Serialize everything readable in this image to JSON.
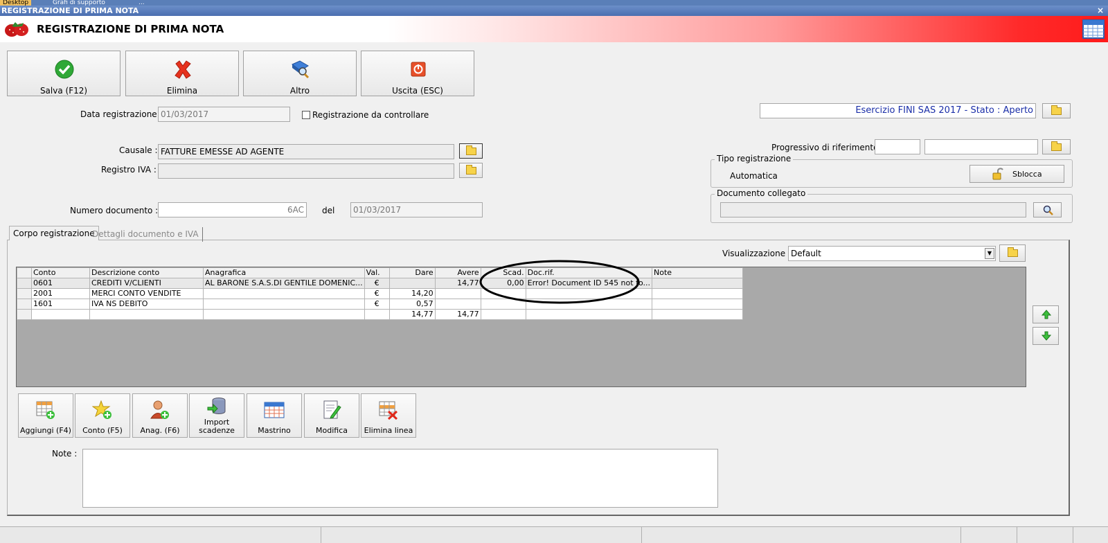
{
  "taskbar": {
    "tabs": [
      "Desktop",
      "Grafi di supporto",
      "..."
    ]
  },
  "window": {
    "title": "REGISTRAZIONE DI PRIMA NOTA",
    "close": "×"
  },
  "header": {
    "title": "REGISTRAZIONE DI PRIMA NOTA"
  },
  "toolbar": {
    "save": "Salva (F12)",
    "delete": "Elimina",
    "other": "Altro",
    "exit": "Uscita (ESC)"
  },
  "form": {
    "data_registrazione_label": "Data registrazione :",
    "data_registrazione": "01/03/2017",
    "da_controllare_label": "Registrazione da controllare",
    "causale_label": "Causale :",
    "causale": "FATTURE EMESSE AD AGENTE",
    "registro_iva_label": "Registro IVA :",
    "registro_iva": "",
    "numero_documento_label": "Numero documento :",
    "numero_documento": "6AC",
    "del_label": "del",
    "data_documento": "01/03/2017"
  },
  "right_panel": {
    "esercizio": "Esercizio FINI SAS 2017 - Stato : Aperto",
    "progressivo_label": "Progressivo di riferimento :",
    "progressivo_1": "",
    "progressivo_2": "",
    "tipo_registrazione_title": "Tipo registrazione",
    "tipo_registrazione": "Automatica",
    "sblocca": "Sblocca",
    "documento_collegato_title": "Documento collegato",
    "documento_collegato": ""
  },
  "tabs": [
    {
      "label": "Corpo registrazione",
      "active": true
    },
    {
      "label": "Dettagli documento e IVA",
      "active": false
    }
  ],
  "visualizzazione": {
    "label": "Visualizzazione :",
    "value": "Default"
  },
  "grid": {
    "columns": [
      "Conto",
      "Descrizione conto",
      "Anagrafica",
      "Val.",
      "Dare",
      "Avere",
      "Scad.",
      "Doc.rif.",
      "Note"
    ],
    "rows": [
      [
        "0601",
        "CREDITI V/CLIENTI",
        "AL BARONE S.A.S.DI GENTILE DOMENIC...",
        "€",
        "",
        "14,77",
        "0,00",
        "Error! Document ID 545 not fo...",
        ""
      ],
      [
        "2001",
        "MERCI CONTO VENDITE",
        "",
        "€",
        "14,20",
        "",
        "",
        "",
        ""
      ],
      [
        "1601",
        "IVA NS DEBITO",
        "",
        "€",
        "0,57",
        "",
        "",
        "",
        ""
      ]
    ],
    "totals": {
      "dare": "14,77",
      "avere": "14,77"
    }
  },
  "bottom_buttons": {
    "aggiungi": "Aggiungi (F4)",
    "conto": "Conto (F5)",
    "anag": "Anag. (F6)",
    "import_1": "Import",
    "import_2": "scadenze",
    "mastrino": "Mastrino",
    "modifica": "Modifica",
    "elimina_linea": "Elimina linea"
  },
  "note": {
    "label": "Note :",
    "value": ""
  },
  "colors": {
    "accent_red": "#ff1a1a",
    "titlebar_blue": "#4a6eb0",
    "esercizio_text": "#1a2ea8"
  }
}
